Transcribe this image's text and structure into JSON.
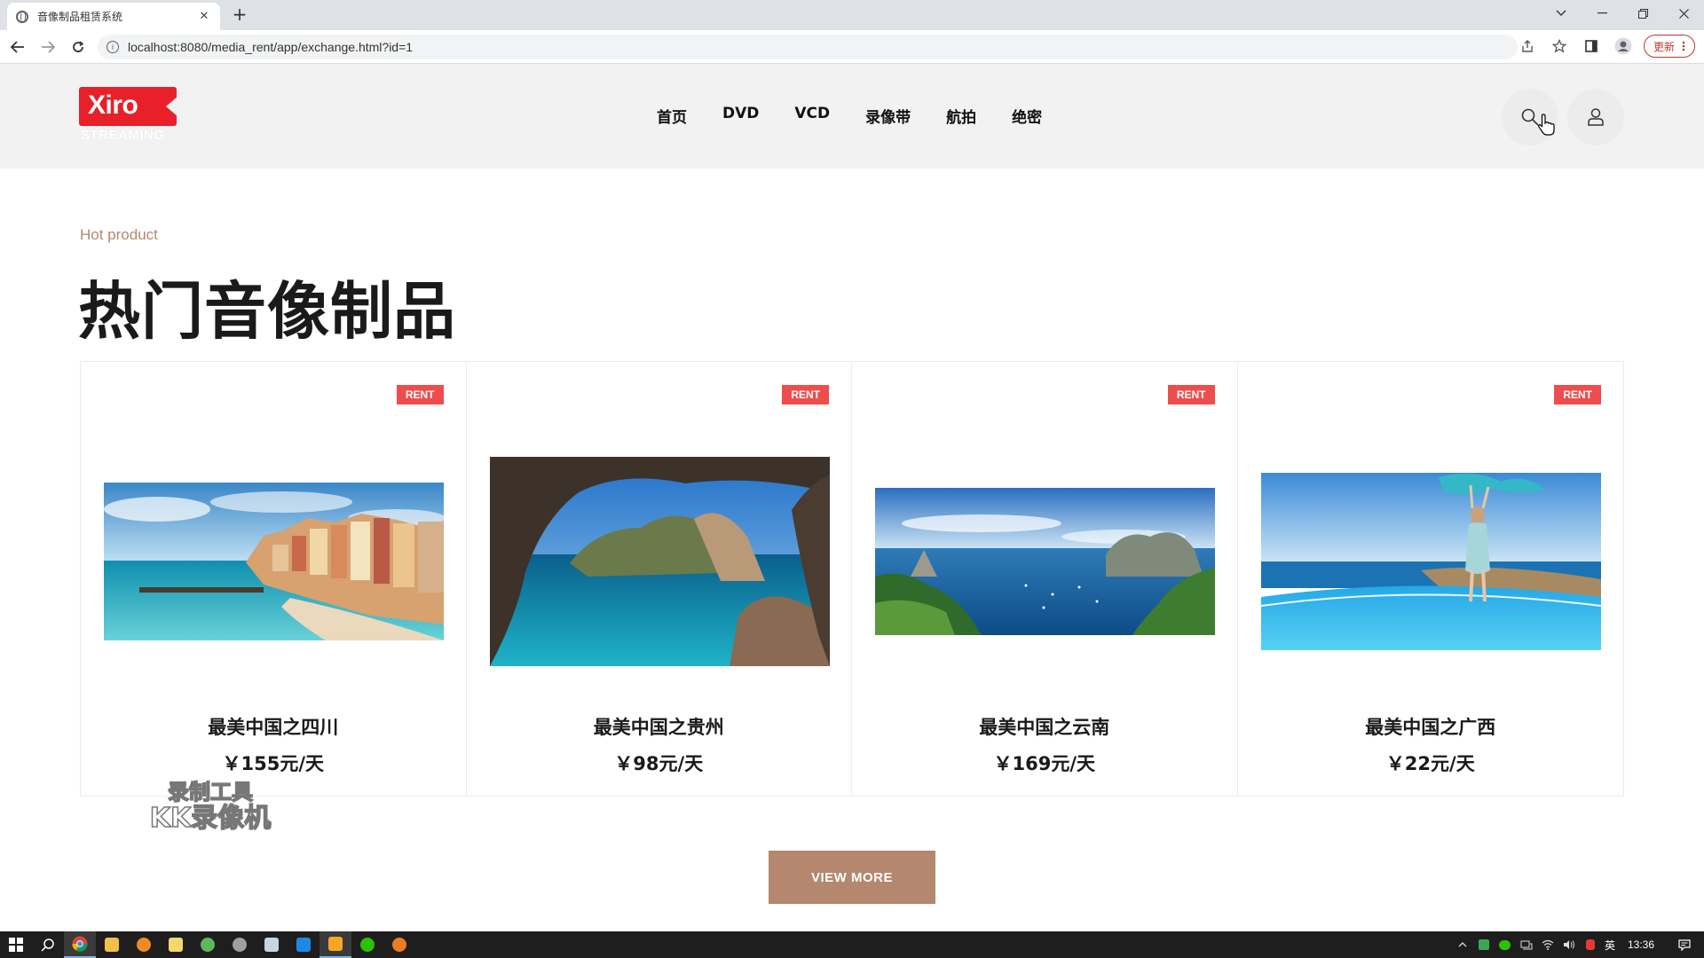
{
  "browser": {
    "tab_title": "音像制品租赁系统",
    "tab_close": "✕",
    "new_tab": "+",
    "url": "localhost:8080/media_rent/app/exchange.html?id=1",
    "update_label": "更新"
  },
  "header": {
    "logo_text": "Xiro",
    "logo_sub": "STREAMING",
    "nav": [
      "首页",
      "DVD",
      "VCD",
      "录像带",
      "航拍",
      "绝密"
    ]
  },
  "section": {
    "subtitle": "Hot product",
    "title": "热门音像制品"
  },
  "products": [
    {
      "badge": "RENT",
      "name": "最美中国之四川",
      "price": "￥155元/天",
      "image": "coastal-village-beach-photo"
    },
    {
      "badge": "RENT",
      "name": "最美中国之贵州",
      "price": "￥98元/天",
      "image": "sea-cave-arch-photo"
    },
    {
      "badge": "RENT",
      "name": "最美中国之云南",
      "price": "￥169元/天",
      "image": "bay-with-boats-photo"
    },
    {
      "badge": "RENT",
      "name": "最美中国之广西",
      "price": "￥22元/天",
      "image": "woman-infinity-pool-photo"
    }
  ],
  "watermark": {
    "line1": "录制工具",
    "line2": "KK录像机"
  },
  "view_more": "VIEW MORE",
  "taskbar": {
    "ime": "英",
    "time": "13:36"
  },
  "colors": {
    "accent": "#b4876e",
    "badge": "#ee4d4d",
    "logo": "#e8202a"
  }
}
